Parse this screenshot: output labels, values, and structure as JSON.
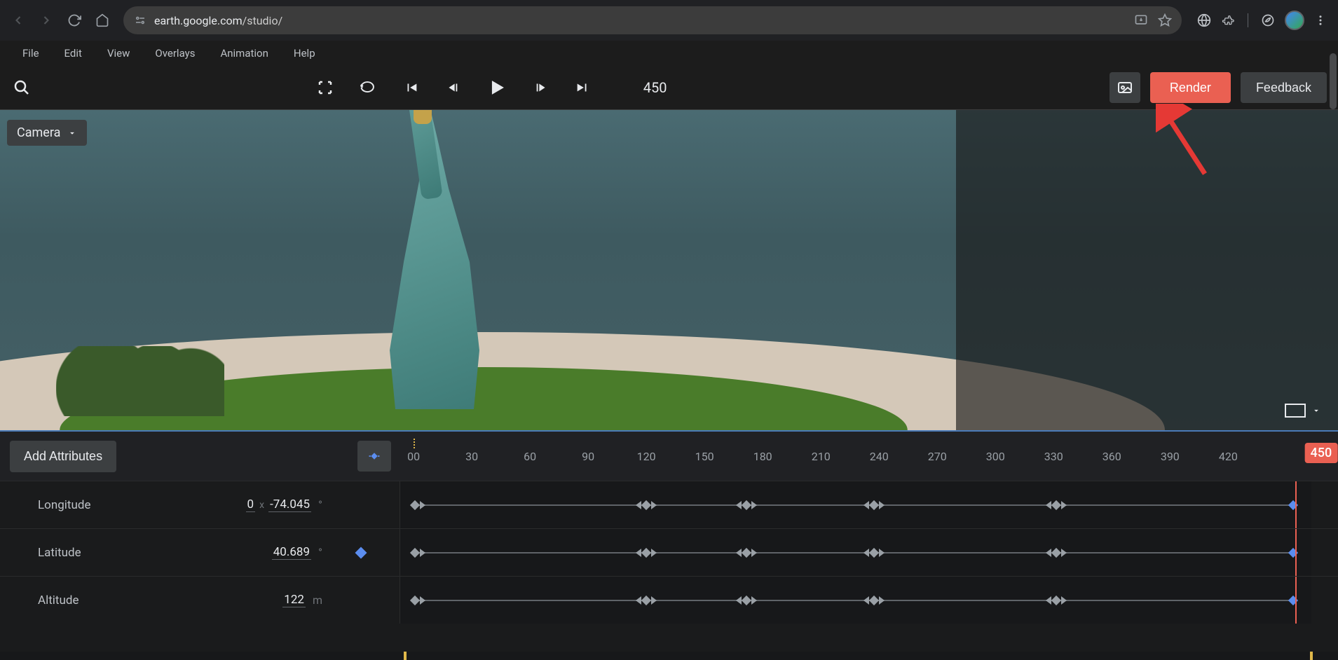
{
  "browser": {
    "url_domain": "earth.google.com",
    "url_path": "/studio/"
  },
  "menu": [
    "File",
    "Edit",
    "View",
    "Overlays",
    "Animation",
    "Help"
  ],
  "toolbar": {
    "frame": "450",
    "render_label": "Render",
    "feedback_label": "Feedback"
  },
  "viewport": {
    "camera_label": "Camera"
  },
  "timeline": {
    "add_attributes_label": "Add Attributes",
    "ruler_ticks": [
      "00",
      "30",
      "60",
      "90",
      "120",
      "150",
      "180",
      "210",
      "240",
      "270",
      "300",
      "330",
      "360",
      "390",
      "420"
    ],
    "playhead_label": "450",
    "rows": [
      {
        "label": "Longitude",
        "offset": "0",
        "value": "-74.045",
        "unit": "°",
        "has_kf": false
      },
      {
        "label": "Latitude",
        "offset": null,
        "value": "40.689",
        "unit": "°",
        "has_kf": true
      },
      {
        "label": "Altitude",
        "offset": null,
        "value": "122",
        "unit": "m",
        "has_kf": false
      }
    ],
    "keyframe_positions_pct": [
      2,
      27,
      38,
      52,
      72
    ],
    "end_kf_pct": 98,
    "playhead_pct": 98.2
  }
}
